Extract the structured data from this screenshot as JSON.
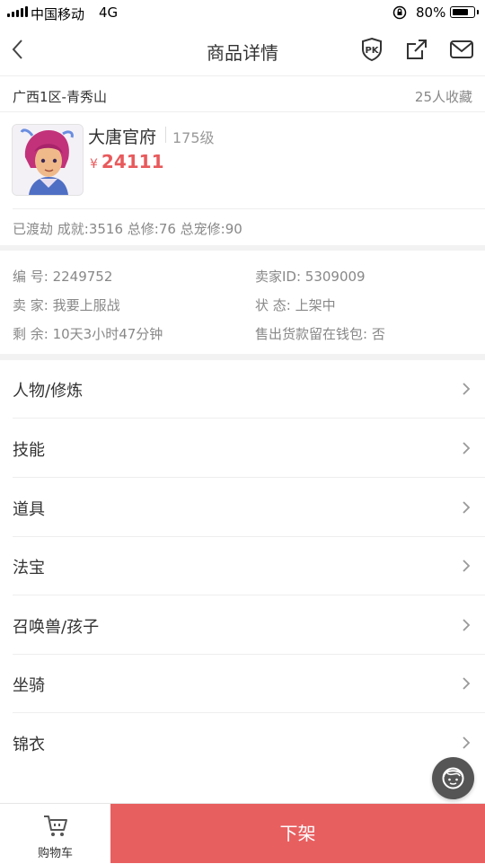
{
  "status_bar": {
    "carrier": "中国移动",
    "network": "4G",
    "battery_percent": "80%",
    "battery_level": 0.8
  },
  "nav": {
    "title": "商品详情"
  },
  "server": {
    "name": "广西1区-青秀山",
    "favorites": "25人收藏"
  },
  "character": {
    "name": "大唐官府",
    "level": "175级",
    "currency": "¥",
    "price": "24111"
  },
  "stats": "已渡劫 成就:3516 总修:76 总宠修:90",
  "info": {
    "id": "编  号: 2249752",
    "seller_id": "卖家ID: 5309009",
    "seller": "卖  家: 我要上服战",
    "status": "状  态: 上架中",
    "remaining": "剩  余: 10天3小时47分钟",
    "wallet": "售出货款留在钱包: 否"
  },
  "list": [
    {
      "label": "人物/修炼"
    },
    {
      "label": "技能"
    },
    {
      "label": "道具"
    },
    {
      "label": "法宝"
    },
    {
      "label": "召唤兽/孩子"
    },
    {
      "label": "坐骑"
    },
    {
      "label": "锦衣"
    }
  ],
  "bottom": {
    "cart_label": "购物车",
    "delist_label": "下架"
  },
  "colors": {
    "accent": "#e85f60",
    "price": "#e85a5c"
  }
}
